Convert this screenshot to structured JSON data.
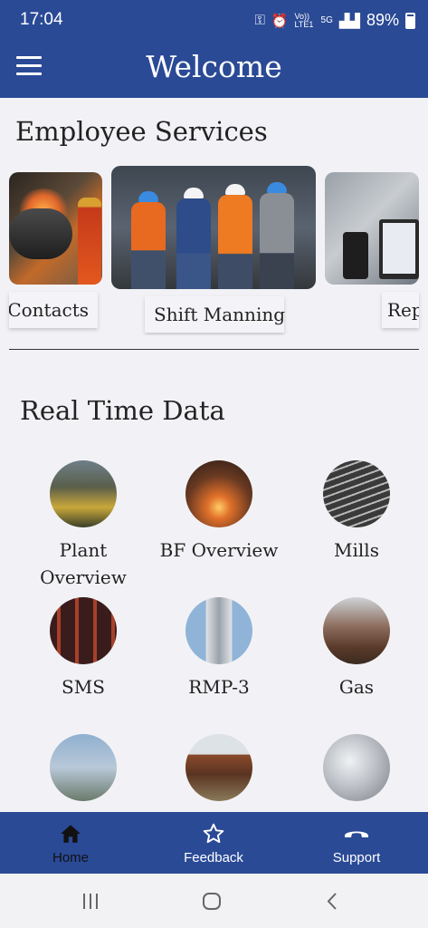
{
  "status_bar": {
    "time": "17:04",
    "network": "Vo)) LTE1",
    "signal_type": "5G",
    "battery": "89%",
    "icons": [
      "key-icon",
      "alarm-icon",
      "signal-icon",
      "battery-icon"
    ]
  },
  "app_bar": {
    "title": "Welcome",
    "menu_icon": "hamburger-icon"
  },
  "employee_services": {
    "title": "Employee Services",
    "cards": [
      {
        "label": "y Contacts",
        "image": "welder-photo"
      },
      {
        "label": "Shift Manning",
        "image": "workers-photo"
      },
      {
        "label": "Rep",
        "image": "reports-photo"
      }
    ]
  },
  "real_time_data": {
    "title": "Real Time Data",
    "items": [
      {
        "label": "Plant Overview",
        "image": "plant-photo"
      },
      {
        "label": "BF Overview",
        "image": "furnace-photo"
      },
      {
        "label": "Mills",
        "image": "mills-photo"
      },
      {
        "label": "SMS",
        "image": "sms-photo"
      },
      {
        "label": "RMP-3",
        "image": "rmp-photo"
      },
      {
        "label": "Gas",
        "image": "gas-photo"
      },
      {
        "label": "",
        "image": "power-photo"
      },
      {
        "label": "",
        "image": "rail-photo"
      },
      {
        "label": "",
        "image": "tanks-photo"
      }
    ]
  },
  "bottom_nav": {
    "items": [
      {
        "label": "Home",
        "icon": "home-icon",
        "active": true
      },
      {
        "label": "Feedback",
        "icon": "star-icon",
        "active": false
      },
      {
        "label": "Support",
        "icon": "phone-icon",
        "active": false
      }
    ]
  },
  "colors": {
    "primary": "#2a4a96",
    "background": "#f2f2f6",
    "active_nav": "#111111",
    "inactive_nav": "#ffffff"
  }
}
